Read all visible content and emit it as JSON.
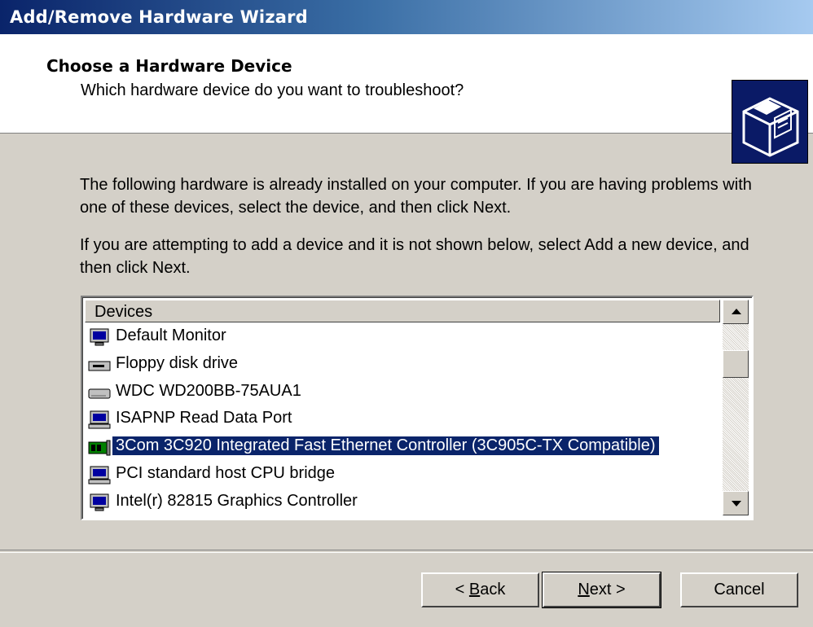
{
  "window": {
    "title": "Add/Remove Hardware Wizard"
  },
  "header": {
    "title": "Choose a Hardware Device",
    "subtitle": "Which hardware device do you want to troubleshoot?",
    "icon": "hardware-wizard-icon"
  },
  "content": {
    "paragraph1": "The following hardware is already installed on your computer. If you are having problems with one of these devices, select the device, and then click Next.",
    "paragraph2": "If you are attempting to add a device and it is not shown below, select Add a new device, and then click Next."
  },
  "devices": {
    "column_header": "Devices",
    "items": [
      {
        "label": "Default Monitor",
        "icon": "monitor-icon",
        "selected": false
      },
      {
        "label": "Floppy disk drive",
        "icon": "floppy-drive-icon",
        "selected": false
      },
      {
        "label": "WDC WD200BB-75AUA1",
        "icon": "hard-disk-icon",
        "selected": false
      },
      {
        "label": "ISAPNP Read Data Port",
        "icon": "computer-icon",
        "selected": false
      },
      {
        "label": "3Com 3C920 Integrated Fast Ethernet Controller (3C905C-TX Compatible)",
        "icon": "network-card-icon",
        "selected": true
      },
      {
        "label": "PCI standard host CPU bridge",
        "icon": "computer-icon",
        "selected": false
      },
      {
        "label": "Intel(r) 82815 Graphics Controller",
        "icon": "monitor-icon",
        "selected": false
      }
    ]
  },
  "buttons": {
    "back_pre": "< ",
    "back_key": "B",
    "back_post": "ack",
    "next_key": "N",
    "next_post": "ext >",
    "cancel": "Cancel"
  },
  "colors": {
    "selection": "#0a246a",
    "dialog_bg": "#d4d0c8",
    "title_gradient_start": "#0a246a",
    "title_gradient_end": "#a6caf0"
  }
}
